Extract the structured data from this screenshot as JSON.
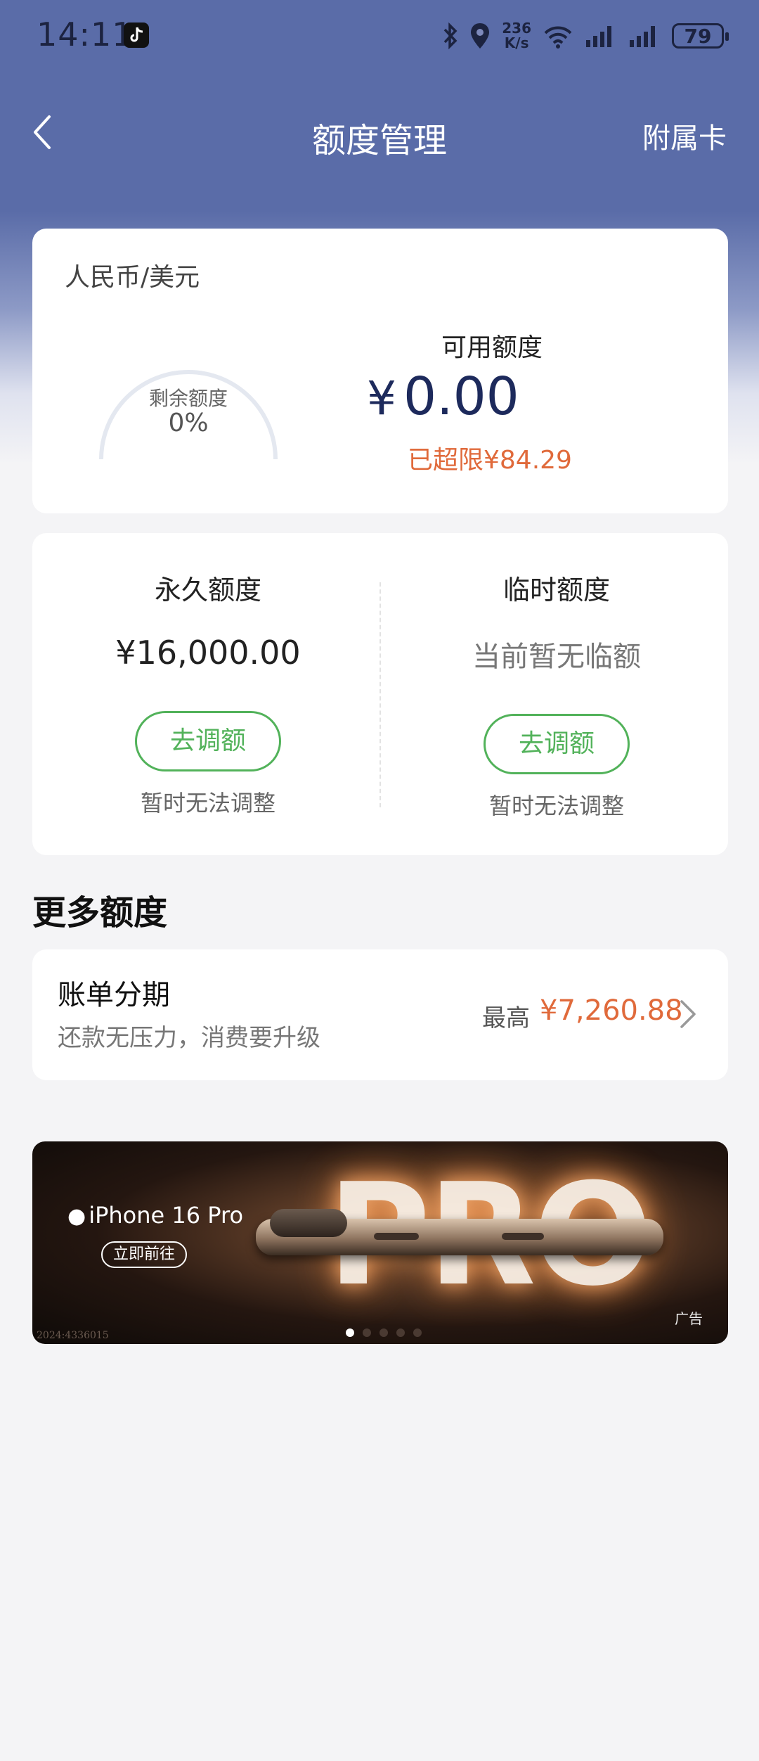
{
  "status_bar": {
    "time": "14:11",
    "net_speed_value": "236",
    "net_speed_unit": "K/s",
    "battery": "79"
  },
  "nav": {
    "title": "额度管理",
    "right_label": "附属卡"
  },
  "summary": {
    "currency": "人民币/美元",
    "remaining_label": "剩余额度",
    "remaining_percent": "0%",
    "remaining_fraction": 0,
    "available_label": "可用额度",
    "available_currency": "¥",
    "available_amount": "0.00",
    "over_limit": "已超限¥84.29"
  },
  "limits": {
    "permanent": {
      "title": "永久额度",
      "value": "¥16,000.00",
      "button": "去调额",
      "note": "暂时无法调整"
    },
    "temporary": {
      "title": "临时额度",
      "value": "当前暂无临额",
      "button": "去调额",
      "note": "暂时无法调整"
    }
  },
  "more": {
    "section_title": "更多额度",
    "installment": {
      "title": "账单分期",
      "subtitle": "还款无压力，消费要升级",
      "max_label": "最高",
      "max_value": "¥7,260.88"
    }
  },
  "banner": {
    "brand": "iPhone 16 Pro",
    "headline": "PRO",
    "cta": "立即前往",
    "ad_tag": "广告",
    "code": "2024:4336015",
    "dots": 5,
    "active_dot": 0
  },
  "colors": {
    "header": "#5a6ca8",
    "accent_green": "#52b25a",
    "accent_orange": "#e06a3b",
    "amount_navy": "#1d2a5c"
  }
}
